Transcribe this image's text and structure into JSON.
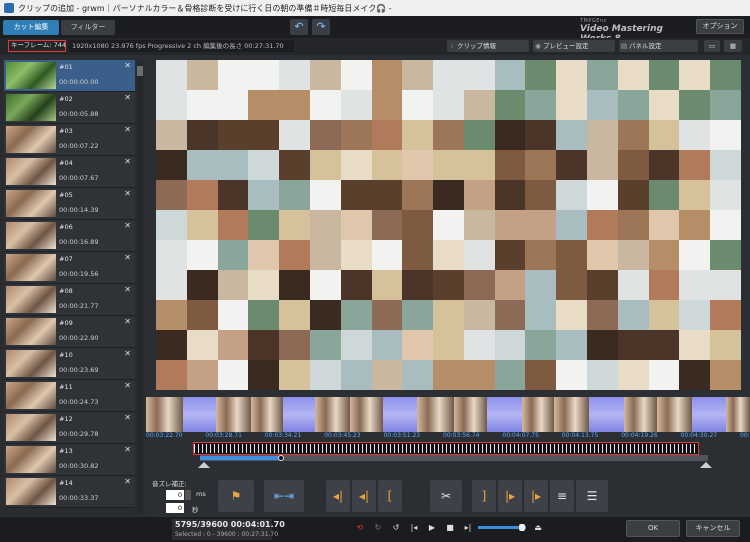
{
  "window": {
    "title": "クリップの追加 - grwm｜パーソナルカラー＆骨格診断を受けに行く日の朝の準備＃時短毎日メイク🎧 -"
  },
  "tabs": [
    {
      "label": "カット編集"
    },
    {
      "label": "フィルター"
    }
  ],
  "brand": {
    "line1": "TMPGEnc",
    "line2": "Video Mastering Works 8"
  },
  "toolbar": {
    "undo_icon": "undo-icon",
    "redo_icon": "redo-icon",
    "option_label": "オプション"
  },
  "info": {
    "keyframes": "キーフレーム: 744",
    "clip_info": "1920x1080 23.976 fps Progressive 2 ch   編集後の長さ 00:27:31.70",
    "clip_info_button": "クリップ情報",
    "preview_settings_button": "プレビュー設定",
    "panel_settings_button": "パネル設定"
  },
  "clips": [
    {
      "num": "#01",
      "time": "00:00:00.00"
    },
    {
      "num": "#02",
      "time": "00:00:05.88"
    },
    {
      "num": "#03",
      "time": "00:00:07.22"
    },
    {
      "num": "#04",
      "time": "00:00:07.67"
    },
    {
      "num": "#05",
      "time": "00:00:14.39"
    },
    {
      "num": "#06",
      "time": "00:00:16.89"
    },
    {
      "num": "#07",
      "time": "00:00:19.56"
    },
    {
      "num": "#08",
      "time": "00:00:21.77"
    },
    {
      "num": "#09",
      "time": "00:00:22.90"
    },
    {
      "num": "#10",
      "time": "00:00:23.69"
    },
    {
      "num": "#11",
      "time": "00:00:24.73"
    },
    {
      "num": "#12",
      "time": "00:00:29.78"
    },
    {
      "num": "#13",
      "time": "00:00:30.82"
    },
    {
      "num": "#14",
      "time": "00:00:33.37"
    }
  ],
  "timeline": {
    "timecodes": [
      "00:03:22.70",
      "00:03:28.71",
      "00:03:34.21",
      "00:03:45.23",
      "00:03:51.23",
      "00:03:56.74",
      "00:04:07.75",
      "00:04:13.75",
      "00:04:19.26",
      "00:04:30.27",
      "00:04:36."
    ],
    "playhead_fraction": 0.16
  },
  "offset": {
    "label": "音ズレ補正:",
    "value": "0",
    "unit": "ms",
    "value2": "0",
    "unit2": "秒"
  },
  "edit_buttons": [
    "set-in-point",
    "split-at-playhead",
    "jump-start",
    "step-back",
    "jump-cut-start",
    "cut",
    "jump-cut-end",
    "step-forward",
    "jump-end",
    "menu"
  ],
  "status": {
    "frame_line": "5795/39600  00:04:01.70",
    "selected_line": "Selected : 0 - 39600 : 00:27:31.70"
  },
  "playback": {
    "volume_fraction": 0.92
  },
  "dialog": {
    "ok_label": "OK",
    "cancel_label": "キャンセル"
  },
  "colors": {
    "accent": "#2f7fb6",
    "highlight": "#e23a3a",
    "timecode": "#5aa9ff"
  }
}
